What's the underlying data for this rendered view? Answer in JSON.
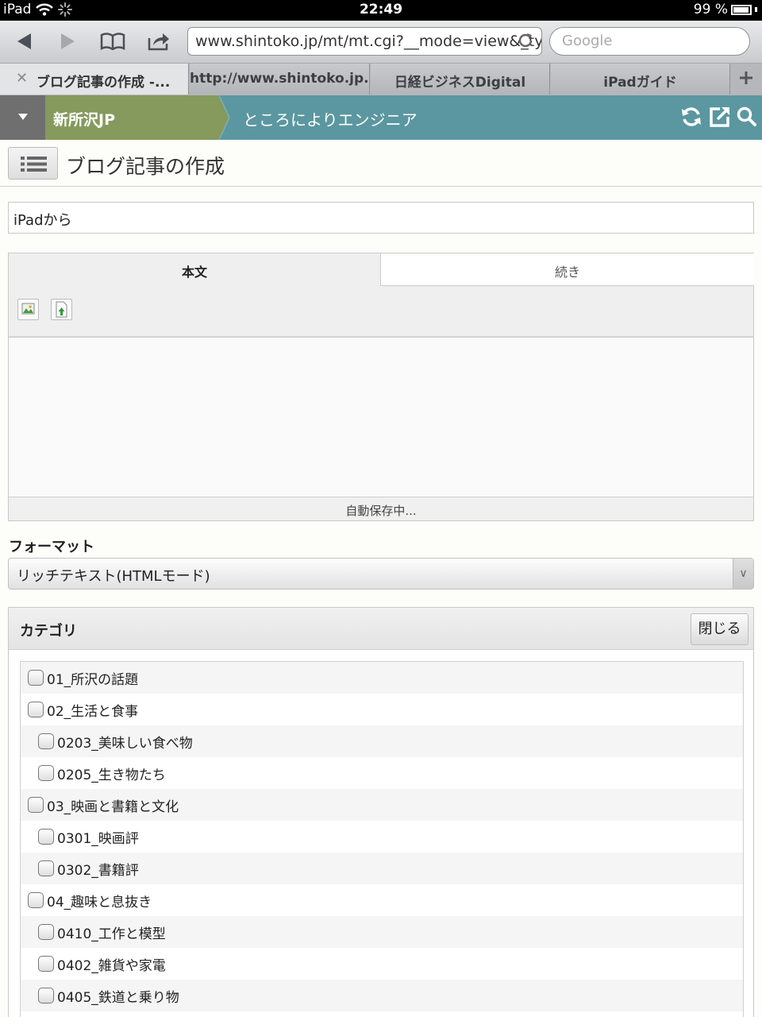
{
  "status": {
    "device": "iPad",
    "time": "22:49",
    "battery": "99 %"
  },
  "browser": {
    "url": "www.shintoko.jp/mt/mt.cgi?__mode=view&_type",
    "search_placeholder": "Google",
    "tabs": [
      {
        "label": "ブログ記事の作成 -..."
      },
      {
        "label": "http://www.shintoko.jp..."
      },
      {
        "label": "日経ビジネスDigital"
      },
      {
        "label": "iPadガイド"
      }
    ]
  },
  "header": {
    "site": "新所沢JP",
    "blog": "ところによりエンジニア"
  },
  "page": {
    "title": "ブログ記事の作成"
  },
  "entry": {
    "title_value": "iPadから"
  },
  "editor": {
    "tab_body": "本文",
    "tab_more": "続き",
    "status": "自動保存中..."
  },
  "format": {
    "label": "フォーマット",
    "selected": "リッチテキスト(HTMLモード)"
  },
  "category": {
    "title": "カテゴリ",
    "close_label": "閉じる",
    "items": [
      {
        "label": "01_所沢の話題",
        "level": 0
      },
      {
        "label": "02_生活と食事",
        "level": 0
      },
      {
        "label": "0203_美味しい食べ物",
        "level": 1
      },
      {
        "label": "0205_生き物たち",
        "level": 1
      },
      {
        "label": "03_映画と書籍と文化",
        "level": 0
      },
      {
        "label": "0301_映画評",
        "level": 1
      },
      {
        "label": "0302_書籍評",
        "level": 1
      },
      {
        "label": "04_趣味と息抜き",
        "level": 0
      },
      {
        "label": "0410_工作と模型",
        "level": 1
      },
      {
        "label": "0402_雑貨や家電",
        "level": 1
      },
      {
        "label": "0405_鉄道と乗り物",
        "level": 1
      }
    ]
  },
  "colors": {
    "header_bg": "#5b97a0",
    "crumb_bg": "#869a5e",
    "menu_bg": "#6f6f6f"
  }
}
